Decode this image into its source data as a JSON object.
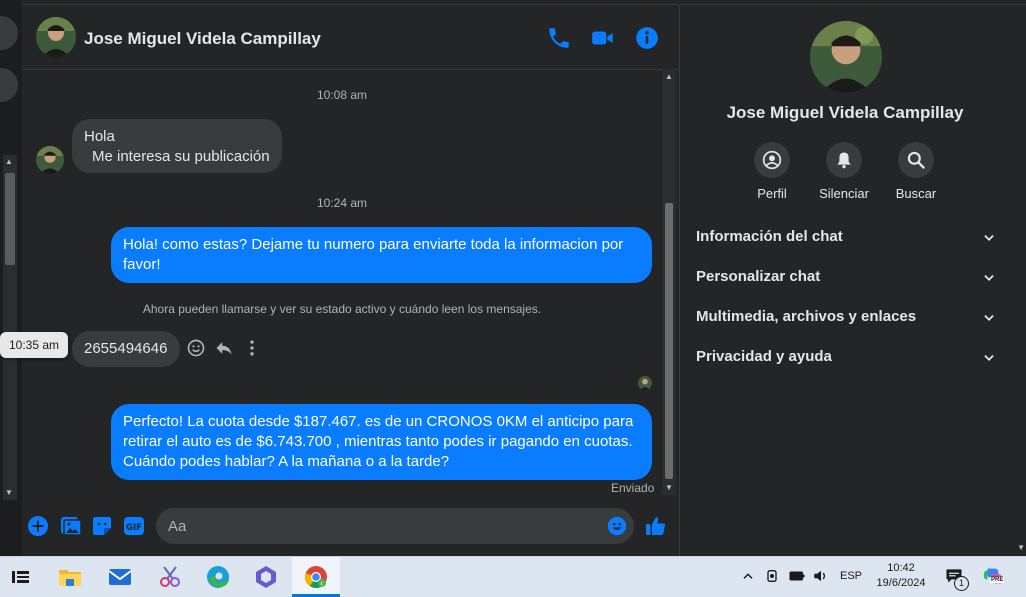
{
  "contact": {
    "name": "Jose Miguel Videla Campillay"
  },
  "messages": {
    "ts1": "10:08 am",
    "in1_line1": "Hola",
    "in1_line2": "Me interesa su publicación",
    "ts2": "10:24 am",
    "out1": "Hola! como estas? Dejame tu numero para enviarte toda la informacion por favor!",
    "system_note": "Ahora pueden llamarse y ver su estado activo y cuándo leen los mensajes.",
    "tooltip_time": "10:35 am",
    "in2": "2655494646",
    "out2_line1": "Perfecto! La cuota desde $187.467. es de un CRONOS 0KM el anticipo para",
    "out2_line2": "retirar el auto es de $6.743.700 , mientras tanto podes ir pagando en cuotas.",
    "out2_line3": "Cuándo podes hablar? A la mañana o a la tarde?",
    "status": "Enviado"
  },
  "composer": {
    "placeholder": "Aa"
  },
  "right_panel": {
    "actions": [
      {
        "label": "Perfil",
        "icon": "profile-icon"
      },
      {
        "label": "Silenciar",
        "icon": "bell-icon"
      },
      {
        "label": "Buscar",
        "icon": "search-icon"
      }
    ],
    "sections": [
      {
        "label": "Información del chat"
      },
      {
        "label": "Personalizar chat"
      },
      {
        "label": "Multimedia, archivos y enlaces"
      },
      {
        "label": "Privacidad y ayuda"
      }
    ]
  },
  "taskbar": {
    "language": "ESP",
    "time": "10:42",
    "date": "19/6/2024",
    "notification_count": "1",
    "copilot_badge": "PRE"
  },
  "colors": {
    "accent": "#0a7cff",
    "background": "#242526",
    "incoming_bubble": "#3a3b3c"
  }
}
